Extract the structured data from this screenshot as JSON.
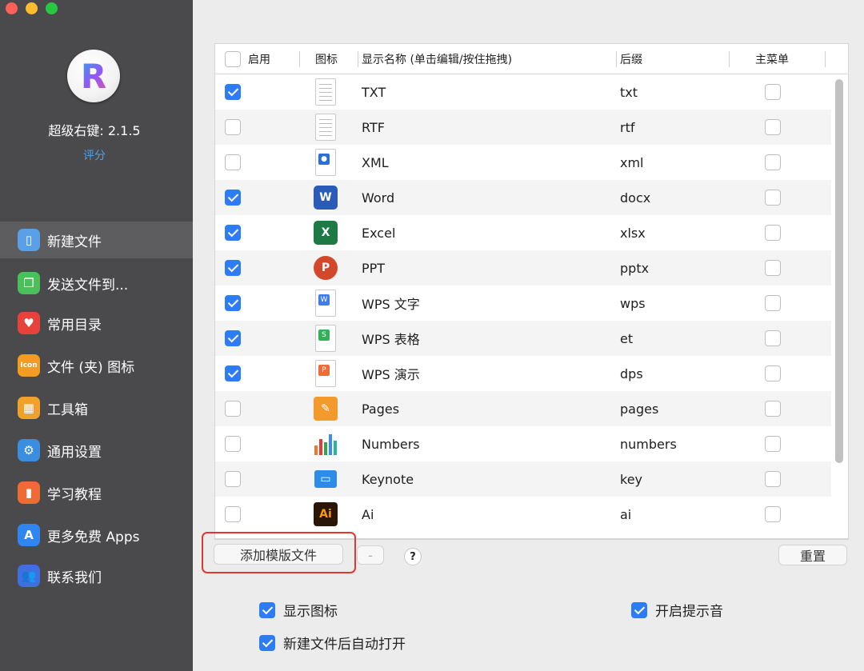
{
  "sidebar": {
    "app_name_version": "超级右键: 2.1.5",
    "rate_link": "评分",
    "items": [
      {
        "label": "新建文件",
        "icon": "new-file-icon",
        "color": "#5aa0e8",
        "glyph": "▯"
      },
      {
        "label": "发送文件到...",
        "icon": "send-file-icon",
        "color": "#4bbf5a",
        "glyph": "❐"
      },
      {
        "label": "常用目录",
        "icon": "heart-icon",
        "color": "#e8423c",
        "glyph": "♥"
      },
      {
        "label": "文件 (夹) 图标",
        "icon": "icon-badge-icon",
        "color": "#f39c1f",
        "glyph": "Icon"
      },
      {
        "label": "工具箱",
        "icon": "toolbox-icon",
        "color": "#f0a12a",
        "glyph": "▦"
      },
      {
        "label": "通用设置",
        "icon": "gear-icon",
        "color": "#3b8de0",
        "glyph": "⚙"
      },
      {
        "label": "学习教程",
        "icon": "book-icon",
        "color": "#f06a35",
        "glyph": "▮"
      },
      {
        "label": "更多免费 Apps",
        "icon": "app-store-icon",
        "color": "#2f86f0",
        "glyph": "A"
      },
      {
        "label": "联系我们",
        "icon": "contacts-icon",
        "color": "#3f6fe0",
        "glyph": "👥"
      }
    ]
  },
  "table": {
    "headers": {
      "enable": "启用",
      "icon": "图标",
      "name": "显示名称 (单击编辑/按住拖拽)",
      "suffix": "后缀",
      "main_menu": "主菜单"
    },
    "rows": [
      {
        "enabled": true,
        "name": "TXT",
        "suffix": "txt",
        "main": false,
        "icon": "txt-file-icon"
      },
      {
        "enabled": false,
        "name": "RTF",
        "suffix": "rtf",
        "main": false,
        "icon": "rtf-file-icon"
      },
      {
        "enabled": false,
        "name": "XML",
        "suffix": "xml",
        "main": false,
        "icon": "xml-file-icon"
      },
      {
        "enabled": true,
        "name": "Word",
        "suffix": "docx",
        "main": false,
        "icon": "word-icon"
      },
      {
        "enabled": true,
        "name": "Excel",
        "suffix": "xlsx",
        "main": false,
        "icon": "excel-icon"
      },
      {
        "enabled": true,
        "name": "PPT",
        "suffix": "pptx",
        "main": false,
        "icon": "powerpoint-icon"
      },
      {
        "enabled": true,
        "name": "WPS 文字",
        "suffix": "wps",
        "main": false,
        "icon": "wps-writer-icon"
      },
      {
        "enabled": true,
        "name": "WPS 表格",
        "suffix": "et",
        "main": false,
        "icon": "wps-spreadsheet-icon"
      },
      {
        "enabled": true,
        "name": "WPS 演示",
        "suffix": "dps",
        "main": false,
        "icon": "wps-presentation-icon"
      },
      {
        "enabled": false,
        "name": "Pages",
        "suffix": "pages",
        "main": false,
        "icon": "pages-icon"
      },
      {
        "enabled": false,
        "name": "Numbers",
        "suffix": "numbers",
        "main": false,
        "icon": "numbers-icon"
      },
      {
        "enabled": false,
        "name": "Keynote",
        "suffix": "key",
        "main": false,
        "icon": "keynote-icon"
      },
      {
        "enabled": false,
        "name": "Ai",
        "suffix": "ai",
        "main": false,
        "icon": "illustrator-icon"
      }
    ]
  },
  "buttons": {
    "add_template": "添加模版文件",
    "remove": "-",
    "help": "?",
    "reset": "重置"
  },
  "options": {
    "show_icon": {
      "label": "显示图标",
      "checked": true
    },
    "play_sound": {
      "label": "开启提示音",
      "checked": true
    },
    "auto_open": {
      "label": "新建文件后自动打开",
      "checked": true
    }
  }
}
